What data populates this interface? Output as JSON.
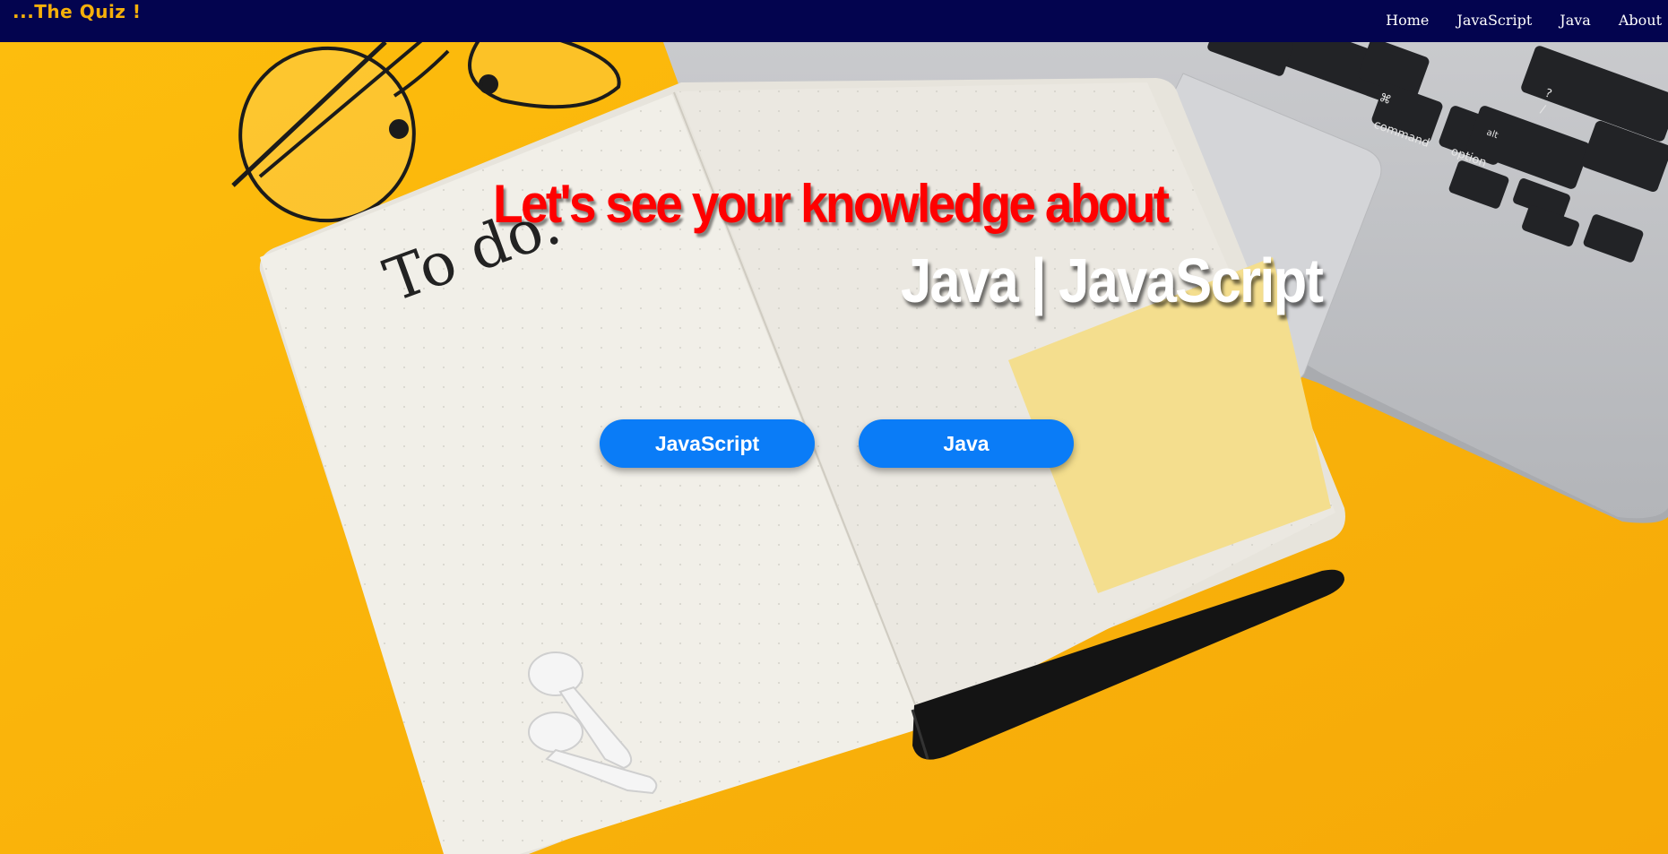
{
  "navbar": {
    "brand": "...The Quiz !",
    "links": [
      "Home",
      "JavaScript",
      "Java",
      "About"
    ]
  },
  "hero": {
    "headline": "Let's see your knowledge about",
    "subhead": "Java | JavaScript"
  },
  "buttons": {
    "javascript": "JavaScript",
    "java": "Java"
  },
  "background_photo": {
    "handwriting": "To do.",
    "keyboard_keys": [
      "command",
      "option",
      "alt",
      "⌘",
      "?",
      "/"
    ]
  },
  "colors": {
    "navbar": "#03044f",
    "brand": "#f5b00a",
    "background": "#fbb90b",
    "headline": "#ff0000",
    "subhead": "#ffffff",
    "button": "#0a7cf7"
  }
}
